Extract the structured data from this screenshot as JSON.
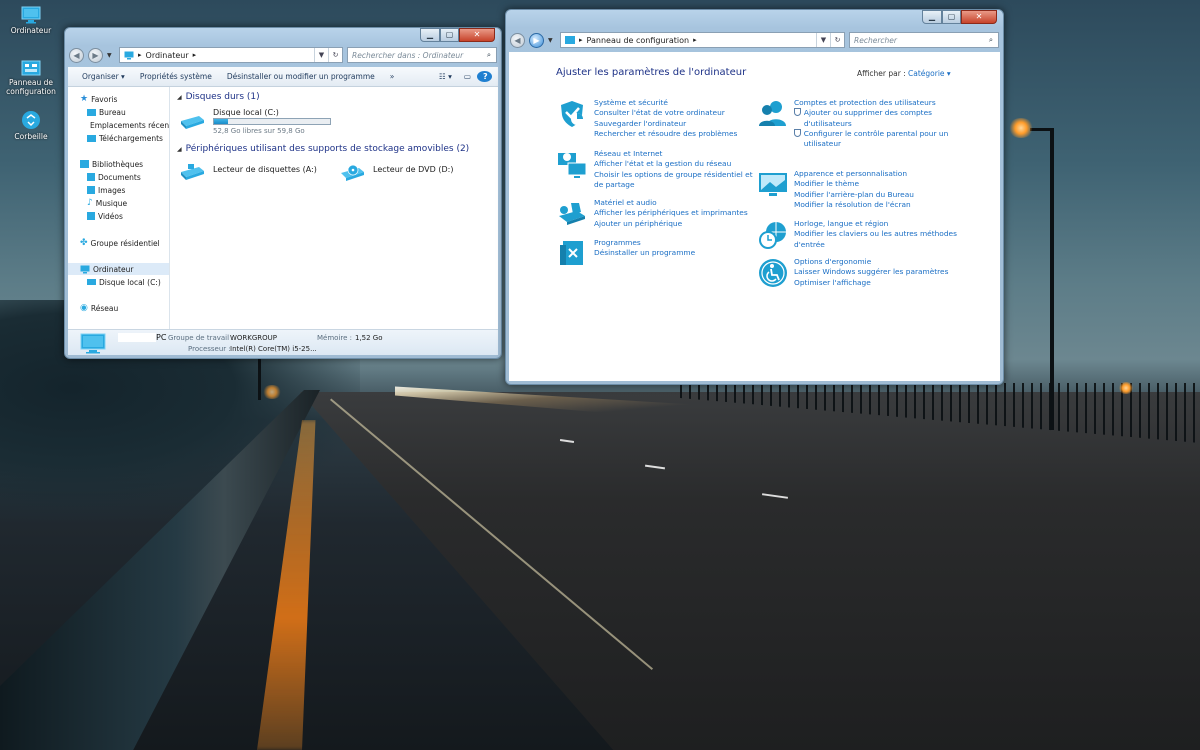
{
  "desktop": {
    "icons": [
      {
        "label": "Ordinateur",
        "icon": "computer-icon"
      },
      {
        "label": "Panneau de configuration",
        "icon": "control-panel-icon"
      },
      {
        "label": "Corbeille",
        "icon": "recycle-bin-icon"
      }
    ]
  },
  "explorer": {
    "address": "Ordinateur",
    "search_placeholder": "Rechercher dans : Ordinateur",
    "commands": [
      "Organiser",
      "Propriétés système",
      "Désinstaller ou modifier un programme",
      "»"
    ],
    "nav": {
      "favorites": "Favoris",
      "fav_items": [
        "Bureau",
        "Emplacements récents",
        "Téléchargements"
      ],
      "libraries": "Bibliothèques",
      "lib_items": [
        "Documents",
        "Images",
        "Musique",
        "Vidéos"
      ],
      "homegroup": "Groupe résidentiel",
      "computer": "Ordinateur",
      "computer_items": [
        "Disque local (C:)"
      ],
      "network": "Réseau"
    },
    "hard_disks_header": "Disques durs (1)",
    "disk": {
      "name": "Disque local (C:)",
      "free_text": "52,8 Go libres sur 59,8 Go",
      "used_fraction": 0.117
    },
    "removable_header": "Périphériques utilisant des supports de stockage amovibles (2)",
    "removable": [
      "Lecteur de disquettes (A:)",
      "Lecteur de DVD (D:)"
    ],
    "details": {
      "name_suffix": "PC",
      "workgroup_label": "Groupe de travail :",
      "workgroup": "WORKGROUP",
      "memory_label": "Mémoire :",
      "memory": "1,52 Go",
      "processor_label": "Processeur :",
      "processor": "Intel(R) Core(TM) i5-25..."
    }
  },
  "control_panel": {
    "address": "Panneau de configuration",
    "search_placeholder": "Rechercher",
    "heading": "Ajuster les paramètres de l'ordinateur",
    "view_by_label": "Afficher par :",
    "view_by_value": "Catégorie",
    "categories": [
      {
        "title": "Système et sécurité",
        "icon": "security-shield-icon",
        "links": [
          "Consulter l'état de votre ordinateur",
          "Sauvegarder l'ordinateur",
          "Rechercher et résoudre des problèmes"
        ]
      },
      {
        "title": "Réseau et Internet",
        "icon": "network-icon",
        "links": [
          "Afficher l'état et la gestion du réseau",
          "Choisir les options de groupe résidentiel et de partage"
        ]
      },
      {
        "title": "Matériel et audio",
        "icon": "hardware-sound-icon",
        "links": [
          "Afficher les périphériques et imprimantes",
          "Ajouter un périphérique"
        ]
      },
      {
        "title": "Programmes",
        "icon": "programs-icon",
        "links": [
          "Désinstaller un programme"
        ]
      },
      {
        "title": "Comptes et protection des utilisateurs",
        "icon": "user-accounts-icon",
        "links": [
          "Ajouter ou supprimer des comptes d'utilisateurs",
          "Configurer le contrôle parental pour un utilisateur"
        ]
      },
      {
        "title": "Apparence et personnalisation",
        "icon": "appearance-icon",
        "links": [
          "Modifier le thème",
          "Modifier l'arrière-plan du Bureau",
          "Modifier la résolution de l'écran"
        ]
      },
      {
        "title": "Horloge, langue et région",
        "icon": "clock-globe-icon",
        "links": [
          "Modifier les claviers ou les autres méthodes d'entrée"
        ]
      },
      {
        "title": "Options d'ergonomie",
        "icon": "accessibility-icon",
        "links": [
          "Laisser Windows suggérer les paramètres",
          "Optimiser l'affichage"
        ]
      }
    ]
  },
  "colors": {
    "accent": "#1e9fd0",
    "link": "#1a6ec4",
    "category_title": "#207a2e",
    "heading": "#1e3287"
  }
}
